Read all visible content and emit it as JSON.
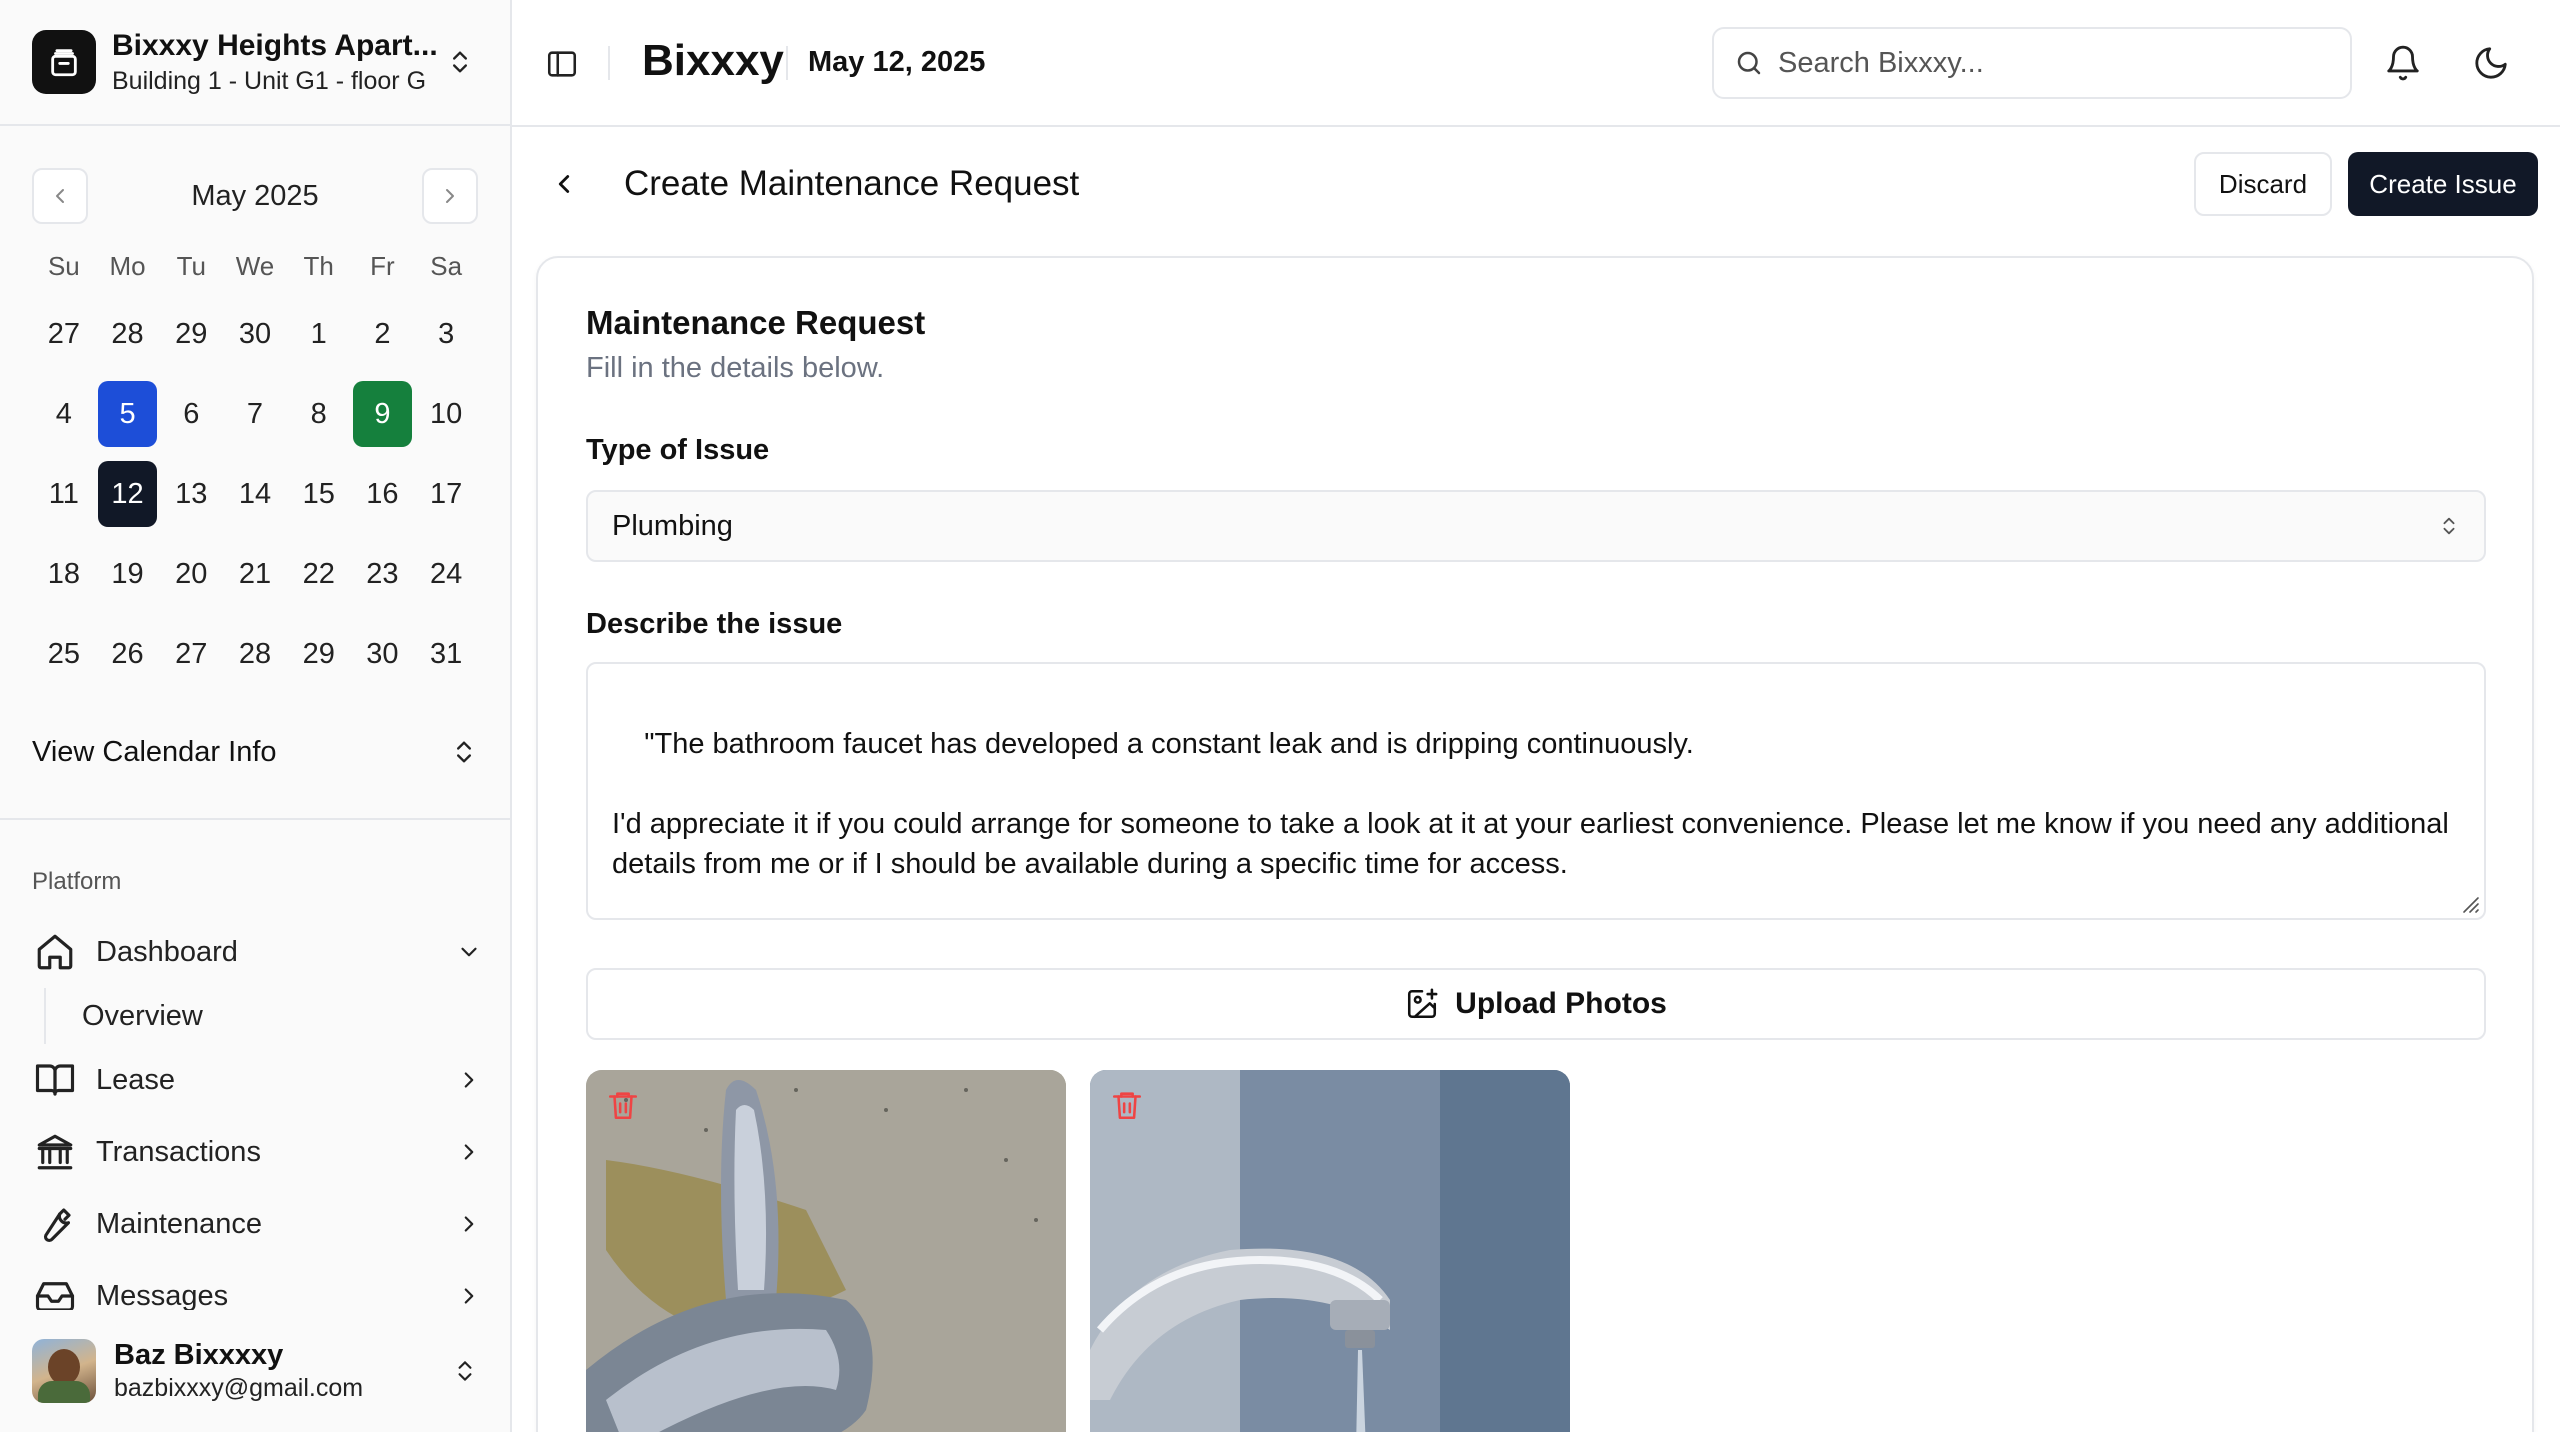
{
  "property": {
    "name": "Bixxxy Heights Apart...",
    "unit": "Building 1 - Unit G1 - floor G"
  },
  "calendar": {
    "month": "May 2025",
    "weekdays": [
      "Su",
      "Mo",
      "Tu",
      "We",
      "Th",
      "Fr",
      "Sa"
    ],
    "days": [
      "27",
      "28",
      "29",
      "30",
      "1",
      "2",
      "3",
      "4",
      "5",
      "6",
      "7",
      "8",
      "9",
      "10",
      "11",
      "12",
      "13",
      "14",
      "15",
      "16",
      "17",
      "18",
      "19",
      "20",
      "21",
      "22",
      "23",
      "24",
      "25",
      "26",
      "27",
      "28",
      "29",
      "30",
      "31"
    ],
    "info_label": "View Calendar Info",
    "highlight_colors": {
      "blue": "#1d4ed8",
      "green": "#15803d",
      "today": "#111827"
    }
  },
  "nav": {
    "section_label": "Platform",
    "items": [
      {
        "label": "Dashboard",
        "icon": "house-icon"
      },
      {
        "label": "Overview"
      },
      {
        "label": "Lease",
        "icon": "book-icon"
      },
      {
        "label": "Transactions",
        "icon": "bank-icon"
      },
      {
        "label": "Maintenance",
        "icon": "wrench-icon"
      },
      {
        "label": "Messages",
        "icon": "inbox-icon"
      }
    ]
  },
  "user": {
    "name": "Baz Bixxxxy",
    "email": "bazbixxxy@gmail.com"
  },
  "topbar": {
    "brand": "Bixxxy",
    "date": "May 12, 2025",
    "search_placeholder": "Search Bixxxy..."
  },
  "page": {
    "title": "Create Maintenance Request",
    "discard_label": "Discard",
    "create_label": "Create Issue"
  },
  "form": {
    "card_title": "Maintenance Request",
    "card_subtitle": "Fill in the details below.",
    "type_label": "Type of Issue",
    "type_value": "Plumbing",
    "description_label": "Describe the issue",
    "description_value": "\"The bathroom faucet has developed a constant leak and is dripping continuously.\n\nI'd appreciate it if you could arrange for someone to take a look at it at your earliest convenience. Please let me know if you need any additional details from me or if I should be available during a specific time for access.",
    "upload_label": "Upload Photos"
  },
  "colors": {
    "primary_dark": "#111827",
    "border": "#e5e7eb",
    "delete_red": "#ef4444"
  }
}
